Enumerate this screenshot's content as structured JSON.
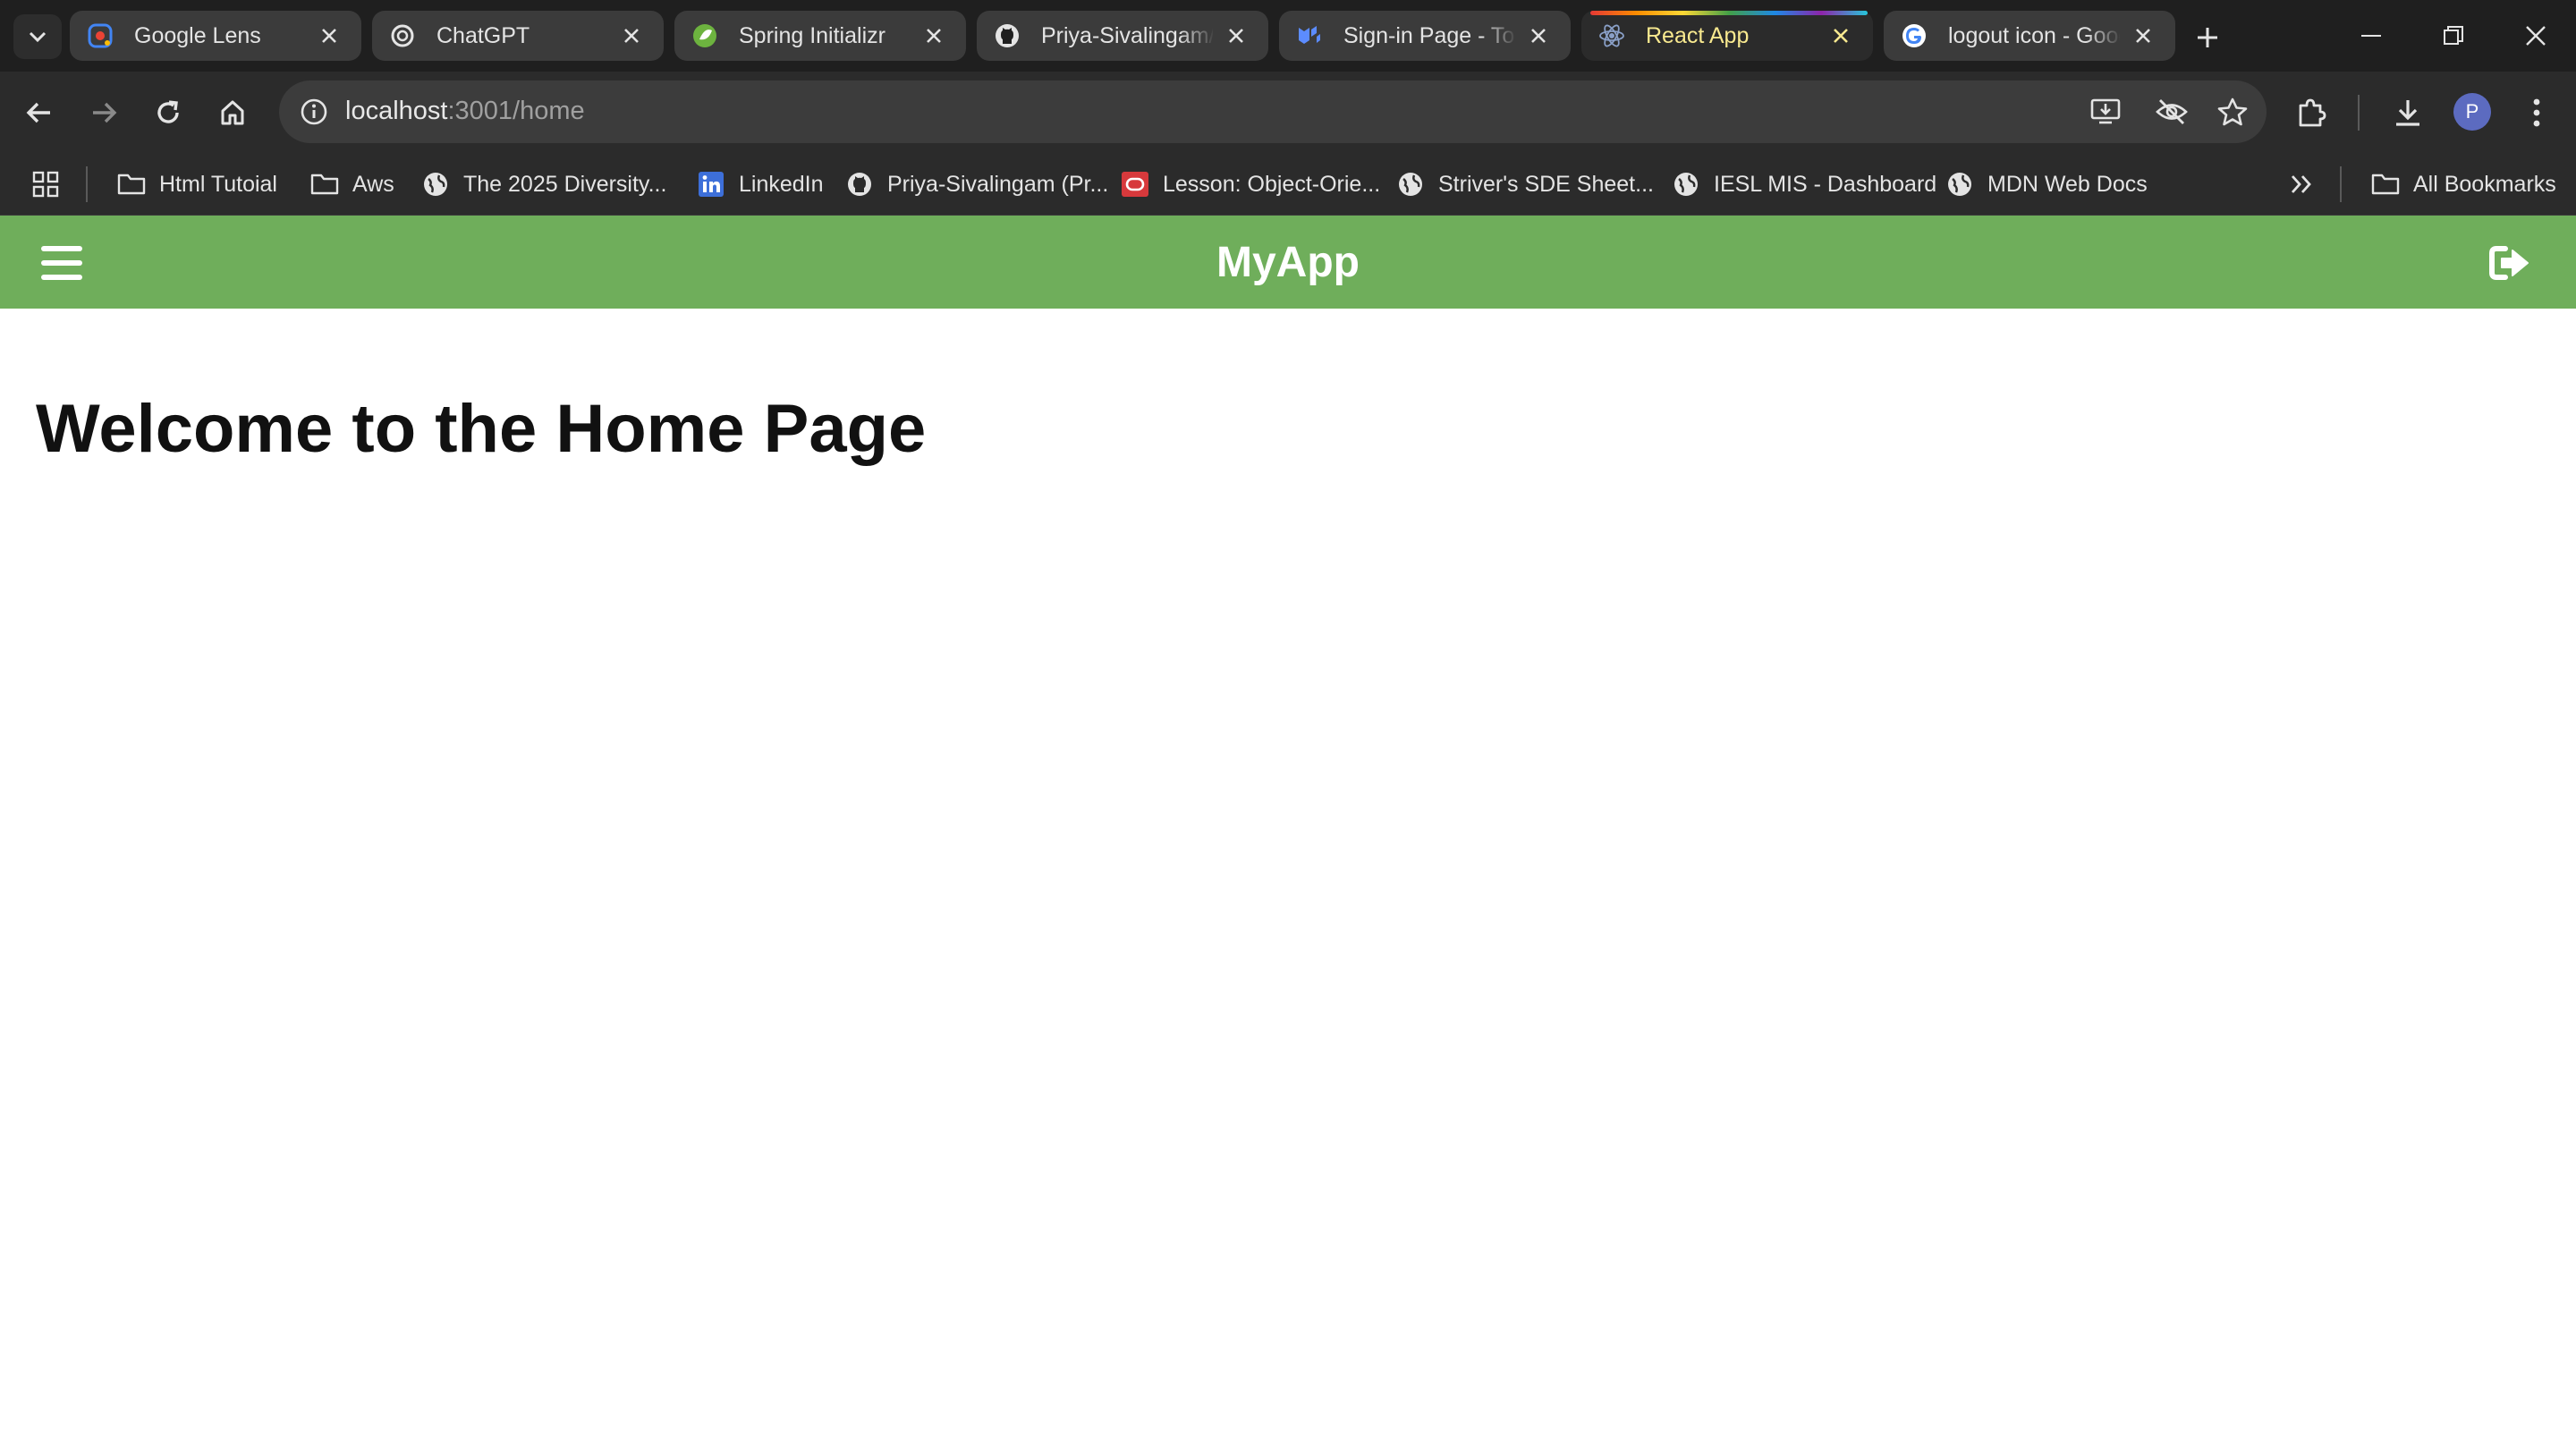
{
  "browser": {
    "tabs": [
      {
        "title": "Google Lens",
        "icon": "google-lens-icon"
      },
      {
        "title": "ChatGPT",
        "icon": "chatgpt-icon"
      },
      {
        "title": "Spring Initializr",
        "icon": "spring-icon"
      },
      {
        "title": "Priya-Sivalingam/S",
        "icon": "github-icon"
      },
      {
        "title": "Sign-in Page - Too",
        "icon": "mui-icon"
      },
      {
        "title": "React App",
        "icon": "react-icon",
        "active": true
      },
      {
        "title": "logout icon - Goog",
        "icon": "google-icon"
      }
    ],
    "address": {
      "host": "localhost",
      "path": ":3001/home"
    },
    "profile_initial": "P",
    "bookmarks": [
      {
        "label": "Html Tutoial",
        "icon": "folder-icon"
      },
      {
        "label": "Aws",
        "icon": "folder-icon"
      },
      {
        "label": "The 2025 Diversity...",
        "icon": "globe-icon"
      },
      {
        "label": "LinkedIn",
        "icon": "linkedin-icon"
      },
      {
        "label": "Priya-Sivalingam (Pr...",
        "icon": "github-icon"
      },
      {
        "label": "Lesson: Object-Orie...",
        "icon": "oracle-icon"
      },
      {
        "label": "Striver's SDE Sheet...",
        "icon": "globe-icon"
      },
      {
        "label": "IESL MIS - Dashboard",
        "icon": "globe-icon"
      },
      {
        "label": "MDN Web Docs",
        "icon": "globe-icon"
      }
    ],
    "all_bookmarks_label": "All Bookmarks"
  },
  "app": {
    "brand": "MyApp",
    "heading": "Welcome to the Home Page",
    "colors": {
      "appbar": "#6fae5b",
      "active_tab_text": "#f8e98f"
    }
  }
}
